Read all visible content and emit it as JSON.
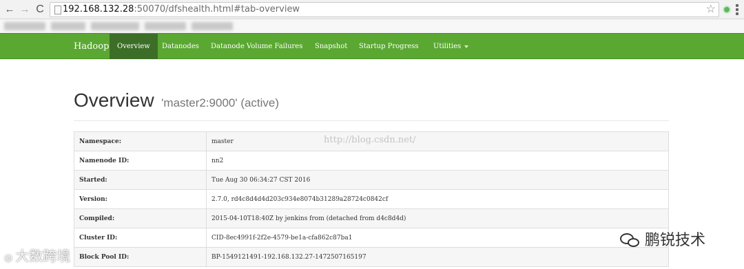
{
  "browser": {
    "url_host": "192.168.132.28",
    "url_rest": ":50070/dfshealth.html#tab-overview",
    "back_icon": "←",
    "forward_icon": "→",
    "reload_icon": "C",
    "star_icon": "☆"
  },
  "navbar": {
    "brand": "Hadoop",
    "items": [
      {
        "label": "Overview",
        "active": true
      },
      {
        "label": "Datanodes"
      },
      {
        "label": "Datanode Volume Failures"
      },
      {
        "label": "Snapshot"
      },
      {
        "label": "Startup Progress"
      },
      {
        "label": "Utilities"
      }
    ]
  },
  "overview": {
    "title": "Overview",
    "subtitle": "'master2:9000' (active)",
    "rows": [
      {
        "key": "Namespace:",
        "value": "master"
      },
      {
        "key": "Namenode ID:",
        "value": "nn2"
      },
      {
        "key": "Started:",
        "value": "Tue Aug 30 06:34:27 CST 2016"
      },
      {
        "key": "Version:",
        "value": "2.7.0, rd4c8d4d4d203c934e8074b31289a28724c0842cf"
      },
      {
        "key": "Compiled:",
        "value": "2015-04-10T18:40Z by jenkins from (detached from d4c8d4d)"
      },
      {
        "key": "Cluster ID:",
        "value": "CID-8ec4991f-2f2e-4579-be1a-cfa862c87ba1"
      },
      {
        "key": "Block Pool ID:",
        "value": "BP-1549121491-192.168.132.27-1472507165197"
      }
    ]
  },
  "watermarks": {
    "center": "http://blog.csdn.net/",
    "left": "大数跨境",
    "right": "鹏锐技术"
  }
}
